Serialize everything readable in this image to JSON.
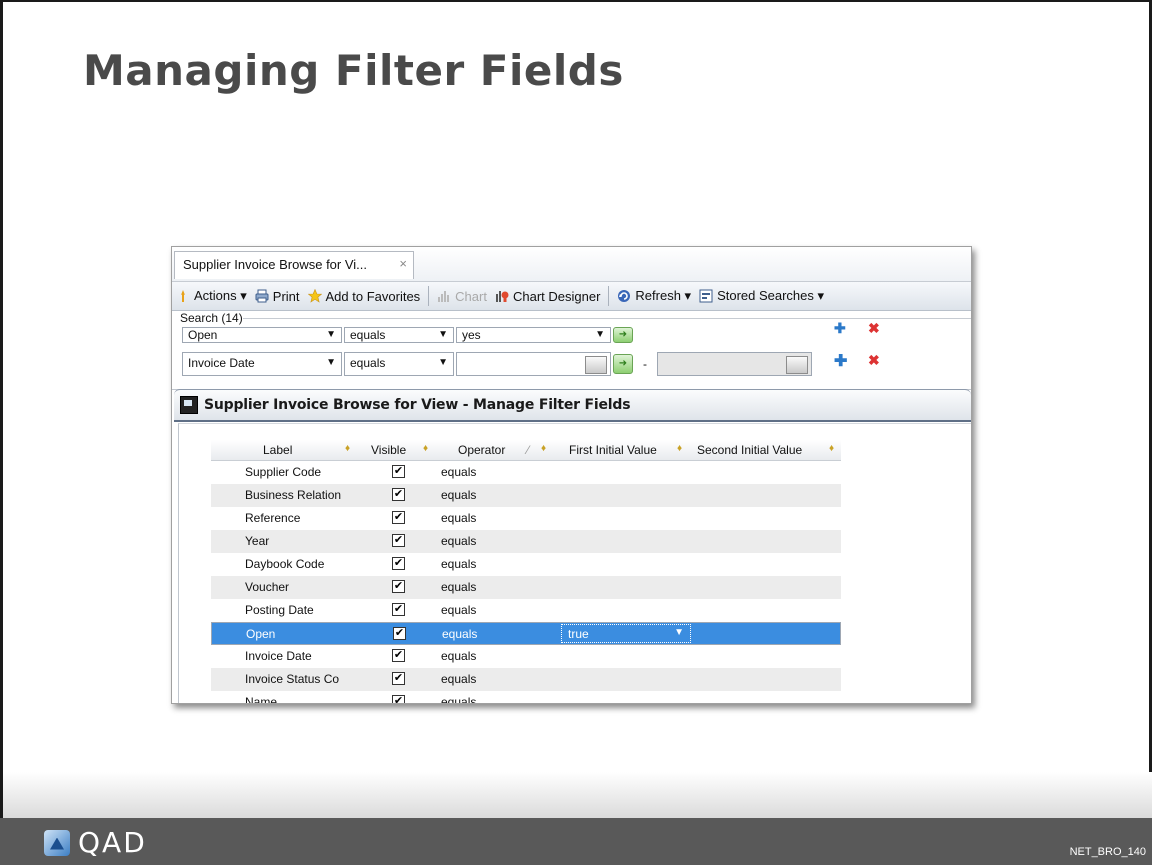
{
  "slide": {
    "title": "Managing Filter Fields",
    "brand": "QAD",
    "code": "NET_BRO_140"
  },
  "app": {
    "tab_label": "Supplier Invoice Browse for Vi...",
    "tab_close": "×",
    "toolbar": {
      "actions": "Actions ▾",
      "print": "Print",
      "add_to_favorites": "Add to Favorites",
      "chart": "Chart",
      "chart_designer": "Chart Designer",
      "refresh": "Refresh ▾",
      "stored_searches": "Stored Searches ▾"
    },
    "search": {
      "label": "Search (14)",
      "rows": [
        {
          "field": "Open",
          "operator": "equals",
          "value": "yes"
        },
        {
          "field": "Invoice Date",
          "operator": "equals",
          "value": "",
          "dash": "-"
        }
      ]
    },
    "manage": {
      "title": "Supplier Invoice Browse for View - Manage Filter Fields",
      "columns": [
        "Label",
        "Visible",
        "Operator",
        "First Initial Value",
        "Second Initial Value"
      ],
      "rows": [
        {
          "label": "Supplier Code",
          "visible": true,
          "operator": "equals",
          "first": ""
        },
        {
          "label": "Business Relation",
          "visible": true,
          "operator": "equals",
          "first": ""
        },
        {
          "label": "Reference",
          "visible": true,
          "operator": "equals",
          "first": ""
        },
        {
          "label": "Year",
          "visible": true,
          "operator": "equals",
          "first": ""
        },
        {
          "label": "Daybook Code",
          "visible": true,
          "operator": "equals",
          "first": ""
        },
        {
          "label": "Voucher",
          "visible": true,
          "operator": "equals",
          "first": ""
        },
        {
          "label": "Posting Date",
          "visible": true,
          "operator": "equals",
          "first": ""
        },
        {
          "label": "Open",
          "visible": true,
          "operator": "equals",
          "first": "true"
        },
        {
          "label": "Invoice Date",
          "visible": true,
          "operator": "equals",
          "first": ""
        },
        {
          "label": "Invoice Status Co",
          "visible": true,
          "operator": "equals",
          "first": ""
        },
        {
          "label": "Name",
          "visible": true,
          "operator": "equals",
          "first": ""
        }
      ]
    }
  },
  "colors": {
    "selection": "#3b8de0",
    "footer": "#595959",
    "title_text": "#4a4a4a"
  }
}
